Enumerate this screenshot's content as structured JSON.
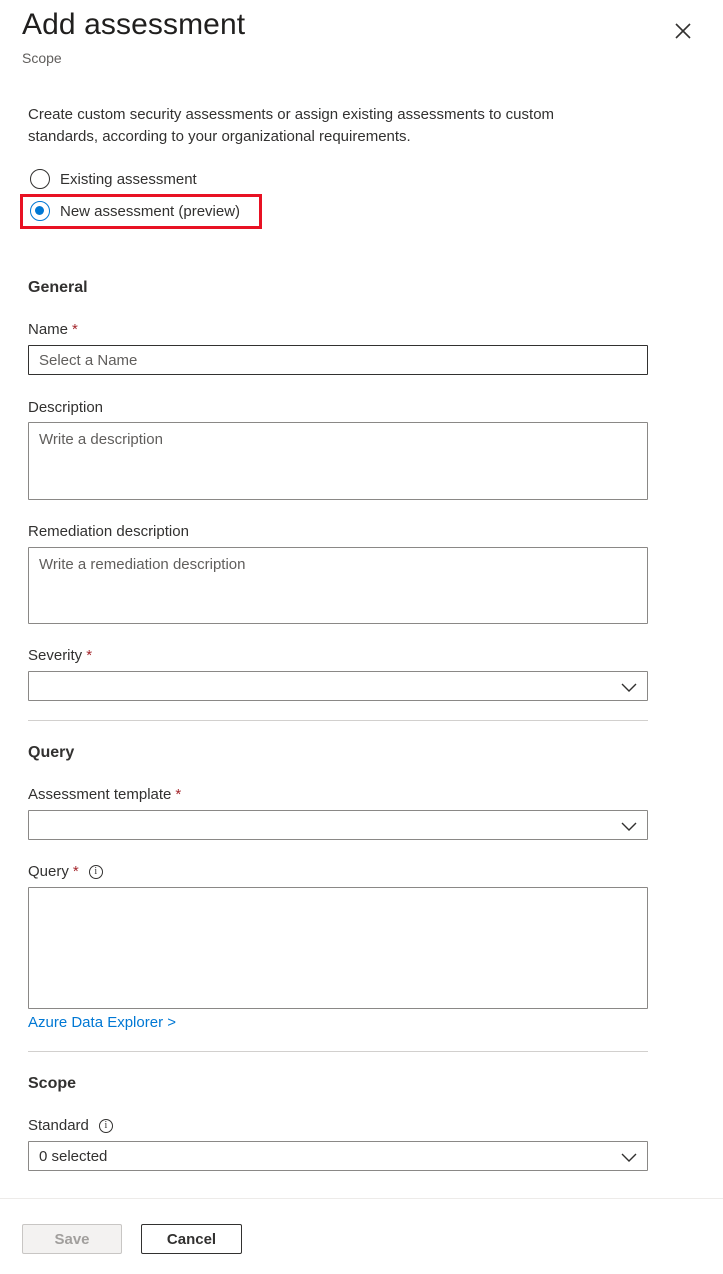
{
  "header": {
    "title": "Add assessment",
    "subtitle": "Scope",
    "close_icon": "close-icon"
  },
  "intro": "Create custom security assessments or assign existing assessments to custom standards, according to your organizational requirements.",
  "assessment_type": {
    "options": [
      {
        "label": "Existing assessment",
        "checked": false
      },
      {
        "label": "New assessment (preview)",
        "checked": true
      }
    ],
    "highlight_color": "#e81123"
  },
  "general": {
    "heading": "General",
    "name_label": "Name",
    "name_placeholder": "Select a Name",
    "description_label": "Description",
    "description_placeholder": "Write a description",
    "remediation_label": "Remediation description",
    "remediation_placeholder": "Write a remediation description",
    "severity_label": "Severity",
    "severity_value": ""
  },
  "query": {
    "heading": "Query",
    "template_label": "Assessment template",
    "template_value": "",
    "query_label": "Query",
    "query_value": "",
    "link": "Azure Data Explorer >"
  },
  "scope": {
    "heading": "Scope",
    "standard_label": "Standard",
    "standard_value": "0 selected"
  },
  "footer": {
    "save_label": "Save",
    "save_enabled": false,
    "cancel_label": "Cancel"
  },
  "required_marker": "*",
  "info_icon_glyph": "i",
  "colors": {
    "accent": "#0078d4",
    "required": "#a4262c",
    "text": "#323130"
  }
}
